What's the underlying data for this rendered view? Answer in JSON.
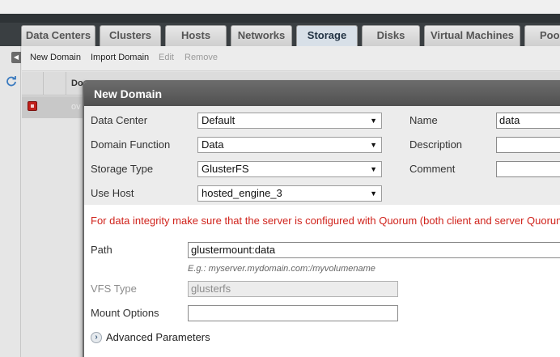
{
  "tabs": [
    {
      "label": "Data Centers",
      "active": false
    },
    {
      "label": "Clusters",
      "active": false
    },
    {
      "label": "Hosts",
      "active": false
    },
    {
      "label": "Networks",
      "active": false
    },
    {
      "label": "Storage",
      "active": true
    },
    {
      "label": "Disks",
      "active": false
    },
    {
      "label": "Virtual Machines",
      "active": false
    },
    {
      "label": "Poo",
      "active": false
    }
  ],
  "toolbar": {
    "new_domain": "New Domain",
    "import_domain": "Import Domain",
    "edit": "Edit",
    "remove": "Remove"
  },
  "grid": {
    "header_label": "Do",
    "row_text": "ov"
  },
  "dialog": {
    "title": "New Domain",
    "fields": {
      "data_center": {
        "label": "Data Center",
        "value": "Default"
      },
      "domain_function": {
        "label": "Domain Function",
        "value": "Data"
      },
      "storage_type": {
        "label": "Storage Type",
        "value": "GlusterFS"
      },
      "use_host": {
        "label": "Use Host",
        "value": "hosted_engine_3"
      },
      "name": {
        "label": "Name",
        "value": "data"
      },
      "description": {
        "label": "Description",
        "value": ""
      },
      "comment": {
        "label": "Comment",
        "value": ""
      }
    },
    "warning": "For data integrity make sure that the server is configured with Quorum (both client and server Quorum)",
    "path": {
      "label": "Path",
      "value": "glustermount:data",
      "hint": "E.g.: myserver.mydomain.com:/myvolumename"
    },
    "vfs_type": {
      "label": "VFS Type",
      "value": "glusterfs"
    },
    "mount_options": {
      "label": "Mount Options",
      "value": ""
    },
    "advanced": {
      "label": "Advanced Parameters"
    }
  },
  "colors": {
    "warning": "#d0231c",
    "dialog_title_bg": "#555555",
    "status_down": "#c0201b"
  },
  "icons": {
    "collapse": "chevron-left-icon",
    "refresh": "refresh-icon",
    "status": "status-down-icon",
    "dropdown": "triangle-down-icon",
    "expand": "chevron-right-icon"
  }
}
